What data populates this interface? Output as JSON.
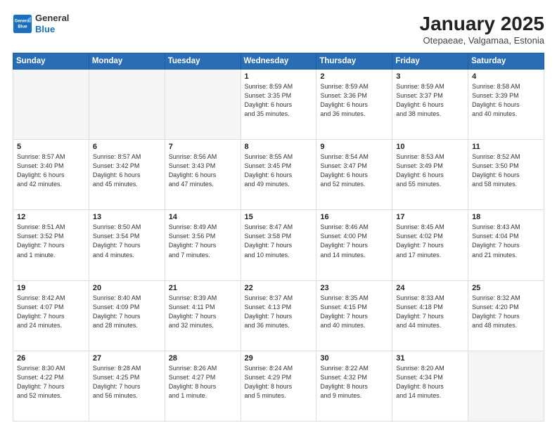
{
  "logo": {
    "general": "General",
    "blue": "Blue"
  },
  "header": {
    "month": "January 2025",
    "location": "Otepaeae, Valgamaa, Estonia"
  },
  "weekdays": [
    "Sunday",
    "Monday",
    "Tuesday",
    "Wednesday",
    "Thursday",
    "Friday",
    "Saturday"
  ],
  "weeks": [
    [
      {
        "day": "",
        "info": ""
      },
      {
        "day": "",
        "info": ""
      },
      {
        "day": "",
        "info": ""
      },
      {
        "day": "1",
        "info": "Sunrise: 8:59 AM\nSunset: 3:35 PM\nDaylight: 6 hours\nand 35 minutes."
      },
      {
        "day": "2",
        "info": "Sunrise: 8:59 AM\nSunset: 3:36 PM\nDaylight: 6 hours\nand 36 minutes."
      },
      {
        "day": "3",
        "info": "Sunrise: 8:59 AM\nSunset: 3:37 PM\nDaylight: 6 hours\nand 38 minutes."
      },
      {
        "day": "4",
        "info": "Sunrise: 8:58 AM\nSunset: 3:39 PM\nDaylight: 6 hours\nand 40 minutes."
      }
    ],
    [
      {
        "day": "5",
        "info": "Sunrise: 8:57 AM\nSunset: 3:40 PM\nDaylight: 6 hours\nand 42 minutes."
      },
      {
        "day": "6",
        "info": "Sunrise: 8:57 AM\nSunset: 3:42 PM\nDaylight: 6 hours\nand 45 minutes."
      },
      {
        "day": "7",
        "info": "Sunrise: 8:56 AM\nSunset: 3:43 PM\nDaylight: 6 hours\nand 47 minutes."
      },
      {
        "day": "8",
        "info": "Sunrise: 8:55 AM\nSunset: 3:45 PM\nDaylight: 6 hours\nand 49 minutes."
      },
      {
        "day": "9",
        "info": "Sunrise: 8:54 AM\nSunset: 3:47 PM\nDaylight: 6 hours\nand 52 minutes."
      },
      {
        "day": "10",
        "info": "Sunrise: 8:53 AM\nSunset: 3:49 PM\nDaylight: 6 hours\nand 55 minutes."
      },
      {
        "day": "11",
        "info": "Sunrise: 8:52 AM\nSunset: 3:50 PM\nDaylight: 6 hours\nand 58 minutes."
      }
    ],
    [
      {
        "day": "12",
        "info": "Sunrise: 8:51 AM\nSunset: 3:52 PM\nDaylight: 7 hours\nand 1 minute."
      },
      {
        "day": "13",
        "info": "Sunrise: 8:50 AM\nSunset: 3:54 PM\nDaylight: 7 hours\nand 4 minutes."
      },
      {
        "day": "14",
        "info": "Sunrise: 8:49 AM\nSunset: 3:56 PM\nDaylight: 7 hours\nand 7 minutes."
      },
      {
        "day": "15",
        "info": "Sunrise: 8:47 AM\nSunset: 3:58 PM\nDaylight: 7 hours\nand 10 minutes."
      },
      {
        "day": "16",
        "info": "Sunrise: 8:46 AM\nSunset: 4:00 PM\nDaylight: 7 hours\nand 14 minutes."
      },
      {
        "day": "17",
        "info": "Sunrise: 8:45 AM\nSunset: 4:02 PM\nDaylight: 7 hours\nand 17 minutes."
      },
      {
        "day": "18",
        "info": "Sunrise: 8:43 AM\nSunset: 4:04 PM\nDaylight: 7 hours\nand 21 minutes."
      }
    ],
    [
      {
        "day": "19",
        "info": "Sunrise: 8:42 AM\nSunset: 4:07 PM\nDaylight: 7 hours\nand 24 minutes."
      },
      {
        "day": "20",
        "info": "Sunrise: 8:40 AM\nSunset: 4:09 PM\nDaylight: 7 hours\nand 28 minutes."
      },
      {
        "day": "21",
        "info": "Sunrise: 8:39 AM\nSunset: 4:11 PM\nDaylight: 7 hours\nand 32 minutes."
      },
      {
        "day": "22",
        "info": "Sunrise: 8:37 AM\nSunset: 4:13 PM\nDaylight: 7 hours\nand 36 minutes."
      },
      {
        "day": "23",
        "info": "Sunrise: 8:35 AM\nSunset: 4:15 PM\nDaylight: 7 hours\nand 40 minutes."
      },
      {
        "day": "24",
        "info": "Sunrise: 8:33 AM\nSunset: 4:18 PM\nDaylight: 7 hours\nand 44 minutes."
      },
      {
        "day": "25",
        "info": "Sunrise: 8:32 AM\nSunset: 4:20 PM\nDaylight: 7 hours\nand 48 minutes."
      }
    ],
    [
      {
        "day": "26",
        "info": "Sunrise: 8:30 AM\nSunset: 4:22 PM\nDaylight: 7 hours\nand 52 minutes."
      },
      {
        "day": "27",
        "info": "Sunrise: 8:28 AM\nSunset: 4:25 PM\nDaylight: 7 hours\nand 56 minutes."
      },
      {
        "day": "28",
        "info": "Sunrise: 8:26 AM\nSunset: 4:27 PM\nDaylight: 8 hours\nand 1 minute."
      },
      {
        "day": "29",
        "info": "Sunrise: 8:24 AM\nSunset: 4:29 PM\nDaylight: 8 hours\nand 5 minutes."
      },
      {
        "day": "30",
        "info": "Sunrise: 8:22 AM\nSunset: 4:32 PM\nDaylight: 8 hours\nand 9 minutes."
      },
      {
        "day": "31",
        "info": "Sunrise: 8:20 AM\nSunset: 4:34 PM\nDaylight: 8 hours\nand 14 minutes."
      },
      {
        "day": "",
        "info": ""
      }
    ]
  ]
}
